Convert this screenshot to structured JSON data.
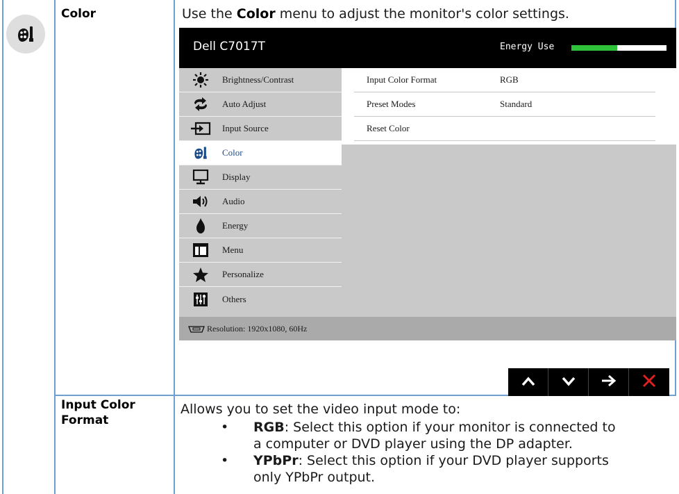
{
  "color_section": {
    "label": "Color",
    "intro_pre": "Use the ",
    "intro_bold": "Color",
    "intro_post": " menu to adjust the monitor's color settings."
  },
  "osd": {
    "brand": "Dell C7017T",
    "energy_label": "Energy Use",
    "energy_level": 0.48,
    "menu_items": [
      {
        "label": "Brightness/Contrast",
        "icon": "brightness-icon"
      },
      {
        "label": "Auto Adjust",
        "icon": "auto-adjust-icon"
      },
      {
        "label": "Input Source",
        "icon": "input-source-icon"
      },
      {
        "label": "Color",
        "icon": "color-icon",
        "active": true
      },
      {
        "label": "Display",
        "icon": "display-icon"
      },
      {
        "label": "Audio",
        "icon": "audio-icon"
      },
      {
        "label": "Energy",
        "icon": "energy-icon"
      },
      {
        "label": "Menu",
        "icon": "menu-icon"
      },
      {
        "label": "Personalize",
        "icon": "star-icon"
      },
      {
        "label": "Others",
        "icon": "others-icon"
      }
    ],
    "settings": [
      {
        "name": "Input Color Format",
        "value": "RGB"
      },
      {
        "name": "Preset Modes",
        "value": "Standard"
      },
      {
        "name": "Reset Color",
        "value": ""
      }
    ],
    "status": "Resolution: 1920x1080, 60Hz",
    "nav_buttons": [
      "up-arrow-icon",
      "down-arrow-icon",
      "right-arrow-icon",
      "close-icon"
    ],
    "colors": {
      "energy_fill": "#2ec23a",
      "close": "#e0201e",
      "active_label": "#1c4b8a"
    }
  },
  "input_color_format": {
    "label_line1": "Input Color",
    "label_line2": "Format",
    "intro": "Allows you to set the video input mode to:",
    "bullet": "•",
    "options": [
      {
        "bold": "RGB",
        "text": ": Select this option if your monitor is connected to",
        "cont": "a computer or DVD player using the DP adapter."
      },
      {
        "bold": "YPbPr",
        "text": ": Select this option if your DVD player supports",
        "cont": "only YPbPr output."
      }
    ]
  }
}
